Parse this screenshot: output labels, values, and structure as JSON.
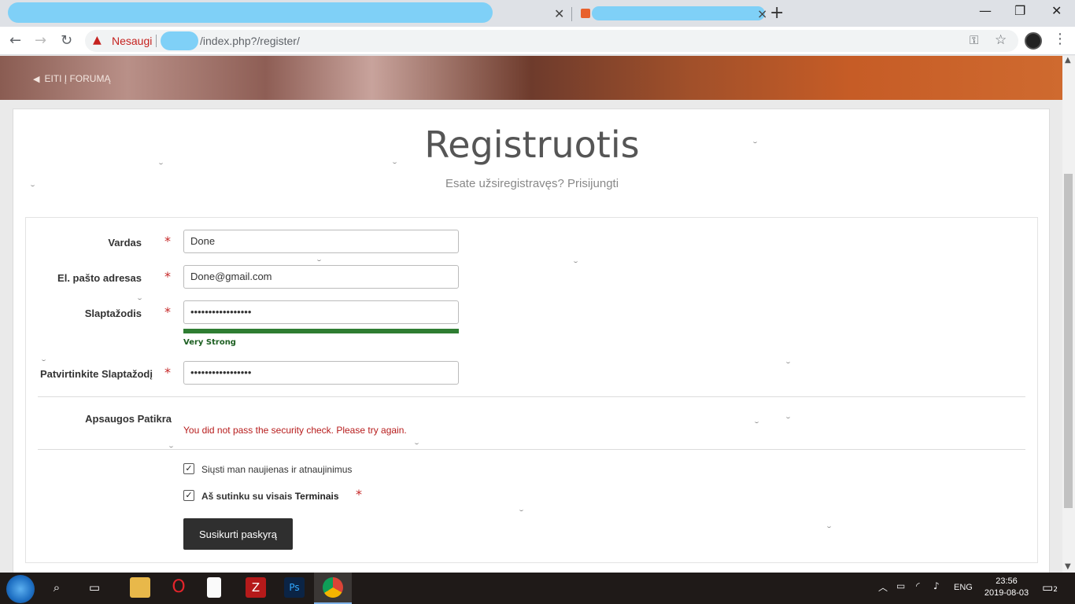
{
  "browser": {
    "tab2_close": "×",
    "new_tab": "+",
    "win_min": "—",
    "win_max": "❐",
    "win_close": "✕",
    "security_label": "Nesaugi",
    "url": "/index.php?/register/"
  },
  "page": {
    "forum_link": "EITI Į FORUMĄ",
    "title": "Registruotis",
    "subtitle": "Esate užsiregistravęs? Prisijungti"
  },
  "form": {
    "name_label": "Vardas",
    "name_value": "Done",
    "email_label": "El. pašto adresas",
    "email_value": "Done@gmail.com",
    "password_label": "Slaptažodis",
    "password_value": "•••••••••••••••••",
    "strength_text": "Very Strong",
    "strength_level": 1.0,
    "confirm_label": "Patvirtinkite Slaptažodį",
    "confirm_value": "•••••••••••••••••",
    "required_mark": "*",
    "security_label": "Apsaugos Patikra",
    "security_error": "You did not pass the security check. Please try again.",
    "newsletter_label": "Siųsti man naujienas ir atnaujinimus",
    "newsletter_checked": true,
    "terms_prefix": "Aš sutinku su visais ",
    "terms_link": "Terminais",
    "terms_checked": true,
    "submit_label": "Susikurti paskyrą"
  },
  "taskbar": {
    "language": "ENG",
    "time": "23:56",
    "date": "2019-08-03",
    "notifications": "2"
  },
  "colors": {
    "accent_error": "#b71c1c",
    "strength_good": "#2e7d32",
    "button_dark": "#2f2f2f"
  }
}
